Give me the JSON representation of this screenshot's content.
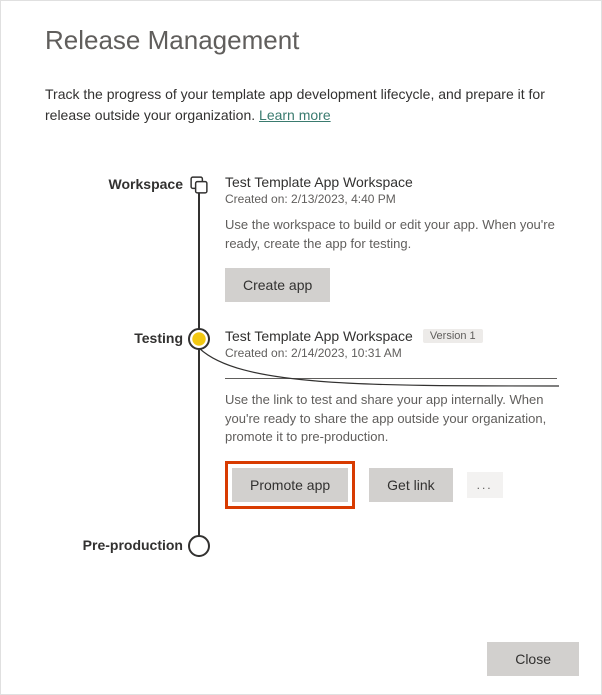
{
  "title": "Release Management",
  "intro_text": "Track the progress of your template app development lifecycle, and prepare it for release outside your organization. ",
  "learn_more": "Learn more",
  "stages": {
    "workspace": {
      "label": "Workspace",
      "title": "Test Template App Workspace",
      "created_prefix": "Created on: ",
      "created": "2/13/2023, 4:40 PM",
      "desc": "Use the workspace to build or edit your app. When you're ready, create the app for testing.",
      "create_button": "Create app"
    },
    "testing": {
      "label": "Testing",
      "title": "Test Template App Workspace",
      "version": "Version 1",
      "created_prefix": "Created on: ",
      "created": "2/14/2023, 10:31 AM",
      "desc": "Use the link to test and share your app internally. When you're ready to share the app outside your organization, promote it to pre-production.",
      "promote_button": "Promote app",
      "get_link_button": "Get link",
      "more": "..."
    },
    "preprod": {
      "label": "Pre-production"
    }
  },
  "close": "Close"
}
